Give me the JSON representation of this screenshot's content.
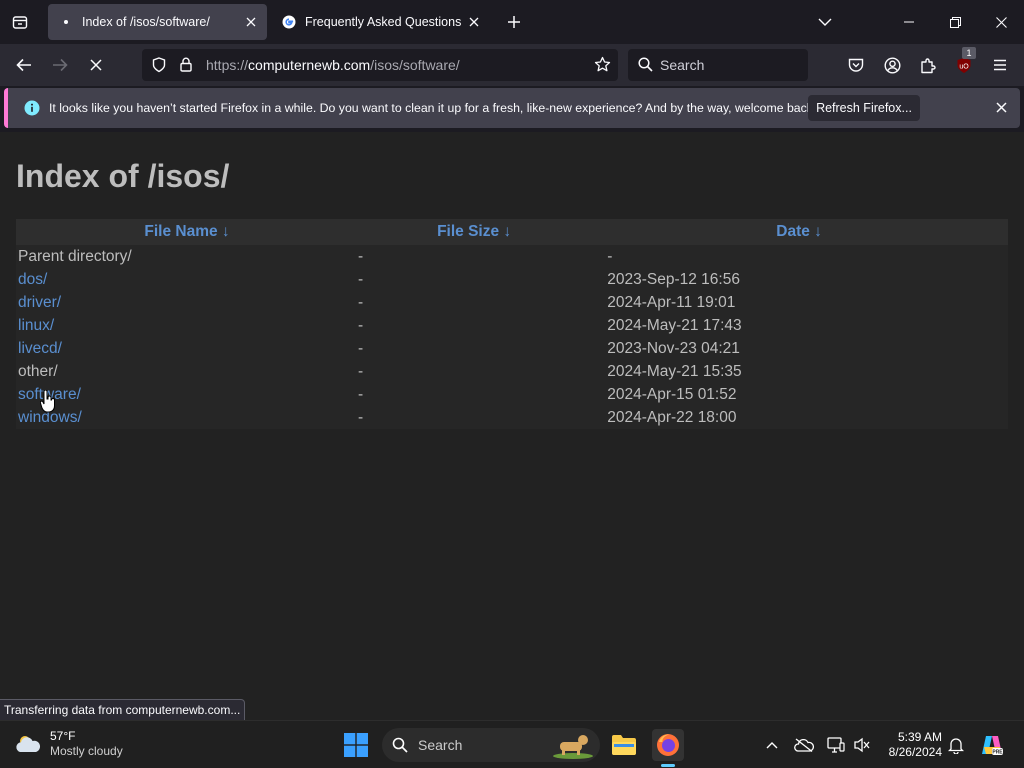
{
  "tabs": [
    {
      "title": "Index of /isos/software/",
      "active": true
    },
    {
      "title": "Frequently Asked Questions  |  G",
      "active": false
    }
  ],
  "navbar": {
    "url_scheme": "https://",
    "url_host": "computernewb.com",
    "url_path": "/isos/software/",
    "search_placeholder": "Search",
    "extension_badge": "1"
  },
  "notification": {
    "message": "It looks like you haven’t started Firefox in a while. Do you want to clean it up for a fresh, like-new experience? And by the way, welcome back!",
    "button": "Refresh Firefox..."
  },
  "page": {
    "title": "Index of /isos/",
    "columns": [
      "File Name  ↓",
      "File Size  ↓",
      "Date  ↓"
    ],
    "rows": [
      {
        "name": "Parent directory/",
        "size": "-",
        "date": "-",
        "link": false
      },
      {
        "name": "dos/",
        "size": "-",
        "date": "2023-Sep-12 16:56",
        "link": true
      },
      {
        "name": "driver/",
        "size": "-",
        "date": "2024-Apr-11 19:01",
        "link": true
      },
      {
        "name": "linux/",
        "size": "-",
        "date": "2024-May-21 17:43",
        "link": true
      },
      {
        "name": "livecd/",
        "size": "-",
        "date": "2023-Nov-23 04:21",
        "link": true
      },
      {
        "name": "other/",
        "size": "-",
        "date": "2024-May-21 15:35",
        "link": false
      },
      {
        "name": "software/",
        "size": "-",
        "date": "2024-Apr-15 01:52",
        "link": true
      },
      {
        "name": "windows/",
        "size": "-",
        "date": "2024-Apr-22 18:00",
        "link": true
      }
    ]
  },
  "status": "Transferring data from computernewb.com...",
  "taskbar": {
    "temperature": "57°F",
    "condition": "Mostly cloudy",
    "search_label": "Search",
    "time": "5:39 AM",
    "date": "8/26/2024"
  }
}
